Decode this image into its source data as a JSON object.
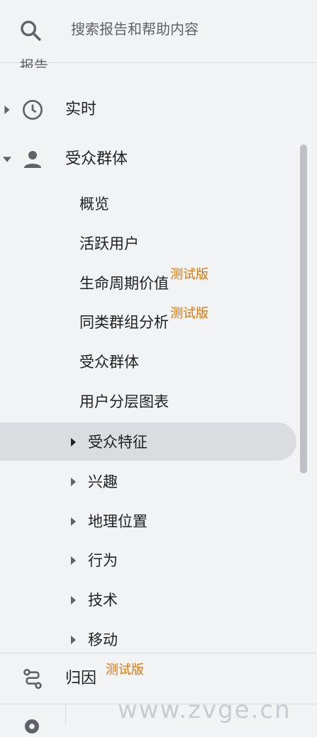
{
  "search": {
    "placeholder": "搜索报告和帮助内容"
  },
  "cut_section_label": "报告",
  "nav": {
    "realtime": "实时",
    "audience": "受众群体"
  },
  "audience_sub": [
    "概览",
    "活跃用户",
    "生命周期价值",
    "同类群组分析",
    "受众群体",
    "用户分层图表"
  ],
  "audience_groups": [
    "受众特征",
    "兴趣",
    "地理位置",
    "行为",
    "技术",
    "移动"
  ],
  "beta_label": "测试版",
  "attribution": "归因",
  "watermark": "www.zvge.cn",
  "colors": {
    "beta": "#e37400",
    "selected": "#dadce0",
    "icon": "#5f6368"
  }
}
